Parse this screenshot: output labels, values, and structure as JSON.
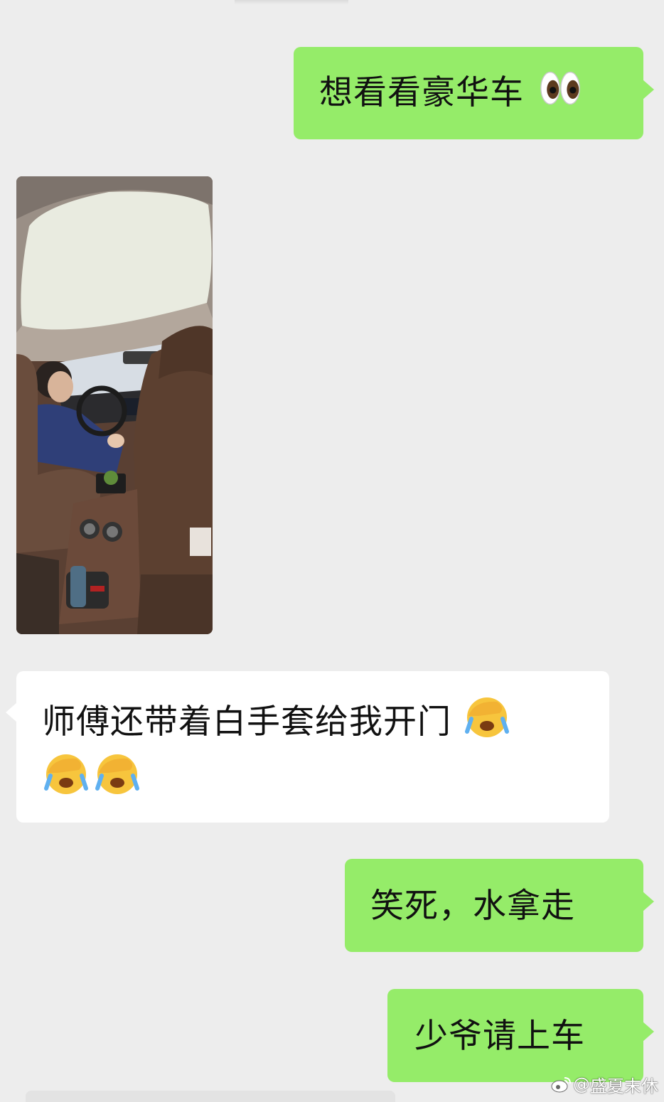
{
  "messages": [
    {
      "id": "m1",
      "side": "out",
      "text": "想看看豪华车",
      "emoji": "eyes"
    },
    {
      "id": "m2",
      "side": "in",
      "type": "image",
      "alt_icon": "photo-car-interior"
    },
    {
      "id": "m3",
      "side": "in",
      "text": "师傅还带着白手套给我开门",
      "emoji": [
        "face-palm-crying",
        "face-palm-crying",
        "face-palm-crying"
      ]
    },
    {
      "id": "m4",
      "side": "out",
      "text": "笑死，水拿走"
    },
    {
      "id": "m5",
      "side": "out",
      "text": "少爷请上车"
    }
  ],
  "watermark": {
    "prefix": "@",
    "name": "盛夏末休",
    "icon": "weibo-logo-icon"
  },
  "colors": {
    "background": "#ededed",
    "outgoing_bubble": "#95ec69",
    "incoming_bubble": "#ffffff"
  }
}
